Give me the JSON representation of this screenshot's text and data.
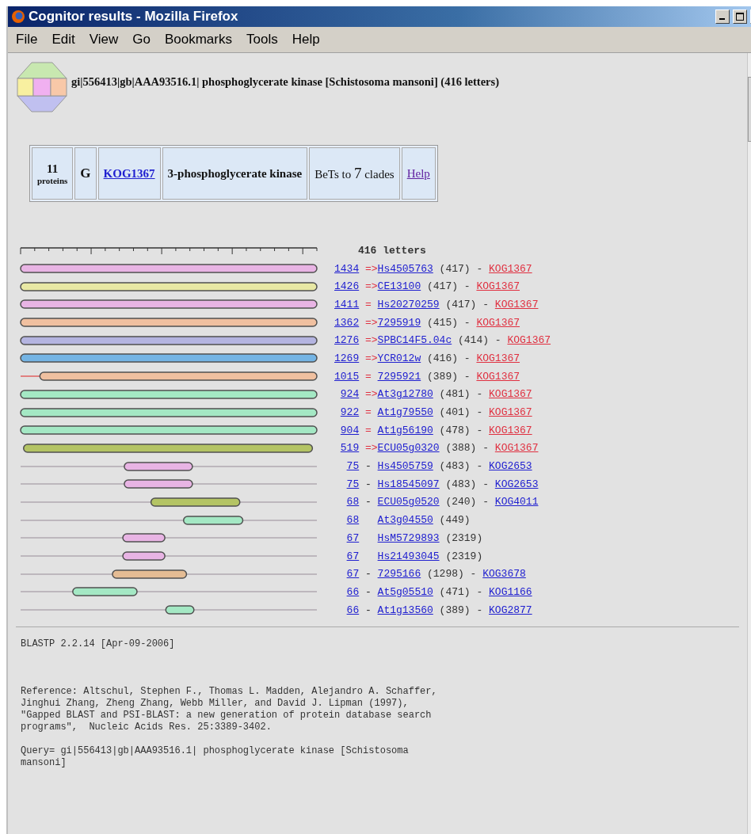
{
  "window": {
    "title": "Cognitor results - Mozilla Firefox"
  },
  "menu": [
    "File",
    "Edit",
    "View",
    "Go",
    "Bookmarks",
    "Tools",
    "Help"
  ],
  "query_title": "gi|556413|gb|AAA93516.1| phosphoglycerate kinase [Schistosoma mansoni] (416 letters)",
  "summary": {
    "count": "11",
    "count_label": "proteins",
    "category": "G",
    "kog": "KOG1367",
    "description": "3-phosphoglycerate kinase",
    "bets_prefix": "BeTs to",
    "bets_count": "7",
    "bets_suffix": "clades",
    "help": "Help"
  },
  "ruler_label": "416 letters",
  "hits": [
    {
      "score": "1434",
      "relation": "=>",
      "name": "Hs4505763",
      "length": "(417)",
      "separator": "-",
      "kog": "KOG1367",
      "highlighted": true,
      "color": "#e8b4e4"
    },
    {
      "score": "1426",
      "relation": "=>",
      "name": "CE13100",
      "length": "(417)",
      "separator": "-",
      "kog": "KOG1367",
      "highlighted": true,
      "color": "#e8e8a4"
    },
    {
      "score": "1411",
      "relation": "=",
      "name": "Hs20270259",
      "length": "(417)",
      "separator": "-",
      "kog": "KOG1367",
      "highlighted": true,
      "color": "#e8b4e4"
    },
    {
      "score": "1362",
      "relation": "=>",
      "name": "7295919",
      "length": "(415)",
      "separator": "-",
      "kog": "KOG1367",
      "highlighted": true,
      "color": "#f0c0a0"
    },
    {
      "score": "1276",
      "relation": "=>",
      "name": "SPBC14F5.04c",
      "length": "(414)",
      "separator": "-",
      "kog": "KOG1367",
      "highlighted": true,
      "color": "#b4b4e0"
    },
    {
      "score": "1269",
      "relation": "=>",
      "name": "YCR012w",
      "length": "(416)",
      "separator": "-",
      "kog": "KOG1367",
      "highlighted": true,
      "color": "#74b4e4"
    },
    {
      "score": "1015",
      "relation": "=",
      "name": "7295921",
      "length": "(389)",
      "separator": "-",
      "kog": "KOG1367",
      "highlighted": true,
      "color": "#f0c0a0"
    },
    {
      "score": "924",
      "relation": "=>",
      "name": "At3g12780",
      "length": "(481)",
      "separator": "-",
      "kog": "KOG1367",
      "highlighted": true,
      "color": "#a4e8c4"
    },
    {
      "score": "922",
      "relation": "=",
      "name": "At1g79550",
      "length": "(401)",
      "separator": "-",
      "kog": "KOG1367",
      "highlighted": true,
      "color": "#a4e8c4"
    },
    {
      "score": "904",
      "relation": "=",
      "name": "At1g56190",
      "length": "(478)",
      "separator": "-",
      "kog": "KOG1367",
      "highlighted": true,
      "color": "#a4e8c4"
    },
    {
      "score": "519",
      "relation": "=>",
      "name": "ECU05g0320",
      "length": "(388)",
      "separator": "-",
      "kog": "KOG1367",
      "highlighted": true,
      "color": "#b4c464"
    },
    {
      "score": "75",
      "relation": "-",
      "name": "Hs4505759",
      "length": "(483)",
      "separator": "-",
      "kog": "KOG2653",
      "highlighted": false,
      "color": "#e8b4e4"
    },
    {
      "score": "75",
      "relation": "-",
      "name": "Hs18545097",
      "length": "(483)",
      "separator": "-",
      "kog": "KOG2653",
      "highlighted": false,
      "color": "#e8b4e4"
    },
    {
      "score": "68",
      "relation": "-",
      "name": "ECU05g0520",
      "length": "(240)",
      "separator": "-",
      "kog": "KOG4011",
      "highlighted": false,
      "color": "#b4c464"
    },
    {
      "score": "68",
      "name": "At3g04550",
      "length": "(449)",
      "highlighted": false,
      "color": "#a4e8c4"
    },
    {
      "score": "67",
      "name": "HsM5729893",
      "length": "(2319)",
      "highlighted": false,
      "color": "#e8b4e4"
    },
    {
      "score": "67",
      "name": "Hs21493045",
      "length": "(2319)",
      "highlighted": false,
      "color": "#e8b4e4"
    },
    {
      "score": "67",
      "relation": "-",
      "name": "7295166",
      "length": "(1298)",
      "separator": "-",
      "kog": "KOG3678",
      "highlighted": false,
      "color": "#e4bc94"
    },
    {
      "score": "66",
      "relation": "-",
      "name": "At5g05510",
      "length": "(471)",
      "separator": "-",
      "kog": "KOG1166",
      "highlighted": false,
      "color": "#a4e8c4"
    },
    {
      "score": "66",
      "relation": "-",
      "name": "At1g13560",
      "length": "(389)",
      "separator": "-",
      "kog": "KOG2877",
      "highlighted": false,
      "color": "#a4e8c4"
    }
  ],
  "blast_version": "BLASTP 2.2.14 [Apr-09-2006]",
  "reference": "Reference: Altschul, Stephen F., Thomas L. Madden, Alejandro A. Schaffer,\nJinghui Zhang, Zheng Zhang, Webb Miller, and David J. Lipman (1997),\n\"Gapped BLAST and PSI-BLAST: a new generation of protein database search\nprograms\",  Nucleic Acids Res. 25:3389-3402.",
  "query_line": "Query= gi|556413|gb|AAA93516.1| phosphoglycerate kinase [Schistosoma\nmansoni]"
}
